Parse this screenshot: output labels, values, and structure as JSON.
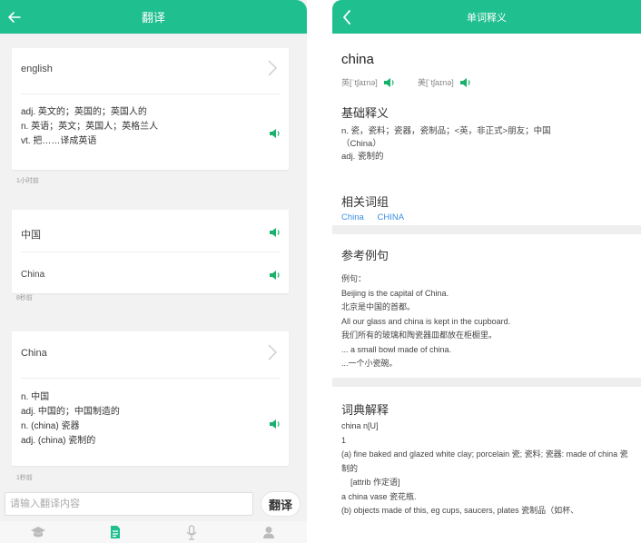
{
  "left": {
    "title": "翻译",
    "cards": [
      {
        "source": "english",
        "lines": [
          "adj. 英文的；英国的；英国人的",
          "n. 英语；英文；英国人；英格兰人",
          "vt. 把……译成英语"
        ],
        "time": "1小时前"
      },
      {
        "source": "中国",
        "result": "China",
        "time": "8秒前"
      },
      {
        "source": "China",
        "lines": [
          "n. 中国",
          "adj. 中国的；中国制造的",
          "n. (china) 瓷器",
          "adj. (china) 瓷制的"
        ],
        "time": "1秒前"
      }
    ],
    "input_placeholder": "请输入翻译内容",
    "translate_label": "翻译"
  },
  "right": {
    "title": "单词释义",
    "word": "china",
    "phonetic_uk": "英[ˈtʃaɪnə]",
    "phonetic_us": "美[ˈtʃaɪnə]",
    "basic_title": "基础释义",
    "basic_lines": [
      "n. 瓷，瓷料；瓷器，瓷制品；<英，非正式>朋友；中国",
      "（China）",
      "adj. 瓷制的"
    ],
    "phrases_title": "相关词组",
    "phrases": [
      "China",
      "CHINA"
    ],
    "examples_title": "参考例句",
    "example_lines": [
      "例句：",
      "Beijing is the capital of China.",
      "北京是中国的首都。",
      "All our glass and china is kept in the cupboard.",
      "我们所有的玻璃和陶瓷器皿都放在柜橱里。",
      "... a small bowl made of china.",
      "...一个小瓷碗。"
    ],
    "dict_title": "词典解释",
    "dict_lines": [
      "china n[U]",
      "1",
      "(a) fine baked and glazed white clay; porcelain 瓷; 瓷料; 瓷器: made of china 瓷制的",
      "    [attrib 作定语]",
      "a china vase 瓷花瓶.",
      "(b) objects made of this, eg cups, saucers, plates 瓷制品（如杯、"
    ]
  },
  "colors": {
    "accent": "#1fbf8f",
    "link": "#3a8ee6",
    "speaker": "#19b26b"
  },
  "icons": [
    "back-arrow-icon",
    "chevron-right-icon",
    "speaker-icon",
    "graduation-cap-icon",
    "document-icon",
    "microphone-icon",
    "user-icon"
  ]
}
